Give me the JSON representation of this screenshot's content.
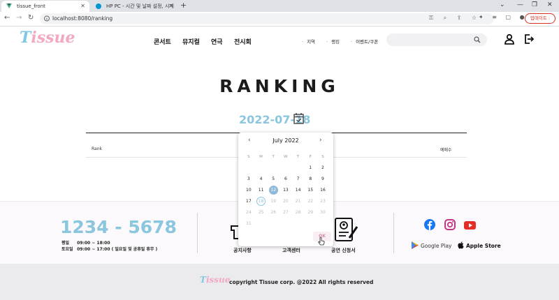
{
  "browser": {
    "tabs": [
      {
        "title": "tissue_front",
        "active": true
      },
      {
        "title": "HP PC - 시간 및 날짜 설정, 시계",
        "active": false
      }
    ],
    "url": "localhost:8080/ranking",
    "update_label": "업데이트 :"
  },
  "header": {
    "logo_t": "T",
    "logo_rest": "issue",
    "main_nav": [
      "콘서트",
      "뮤지컬",
      "연극",
      "전시회"
    ],
    "sub_nav": [
      "지역",
      "랭킹",
      "이벤트/쿠폰"
    ],
    "search_placeholder": ""
  },
  "page": {
    "title": "RANKING",
    "date": "2022-07-18",
    "columns": {
      "rank": "Rank",
      "sales": "예매수"
    }
  },
  "datepicker": {
    "month_label": "July 2022",
    "weekdays": [
      "S",
      "M",
      "T",
      "W",
      "T",
      "F",
      "S"
    ],
    "weeks": [
      [
        "",
        "",
        "",
        "",
        "",
        "1",
        "2"
      ],
      [
        "3",
        "4",
        "5",
        "6",
        "7",
        "8",
        "9"
      ],
      [
        "10",
        "11",
        "12",
        "13",
        "14",
        "15",
        "16"
      ],
      [
        "17",
        "18",
        "19",
        "20",
        "21",
        "22",
        "23"
      ],
      [
        "24",
        "25",
        "26",
        "27",
        "28",
        "29",
        "30"
      ],
      [
        "31",
        "",
        "",
        "",
        "",
        "",
        ""
      ]
    ],
    "selected_day": "12",
    "today_day": "18",
    "ok_label": "OK"
  },
  "footer": {
    "phone": "1234 - 5678",
    "hours": [
      {
        "day": "평일",
        "time": "09:00 ~ 18:00"
      },
      {
        "day": "토요일",
        "time": "09:00 ~ 17:00 ( 일요일 및 공휴일 휴무 )"
      }
    ],
    "links": [
      "공지사항",
      "고객센터",
      "공연 신청서"
    ],
    "stores": [
      "Google Play",
      "Apple Store"
    ],
    "copyright_logo": "Tissue",
    "copyright": "copyright Tissue corp. @2022 All rights reserved"
  },
  "colors": {
    "accent_blue": "#8ac6dd",
    "accent_pink": "#f2a7c3",
    "selected_day": "#8fb9db",
    "facebook": "#1877f2",
    "instagram": "#c13584",
    "youtube": "#e52d27"
  }
}
